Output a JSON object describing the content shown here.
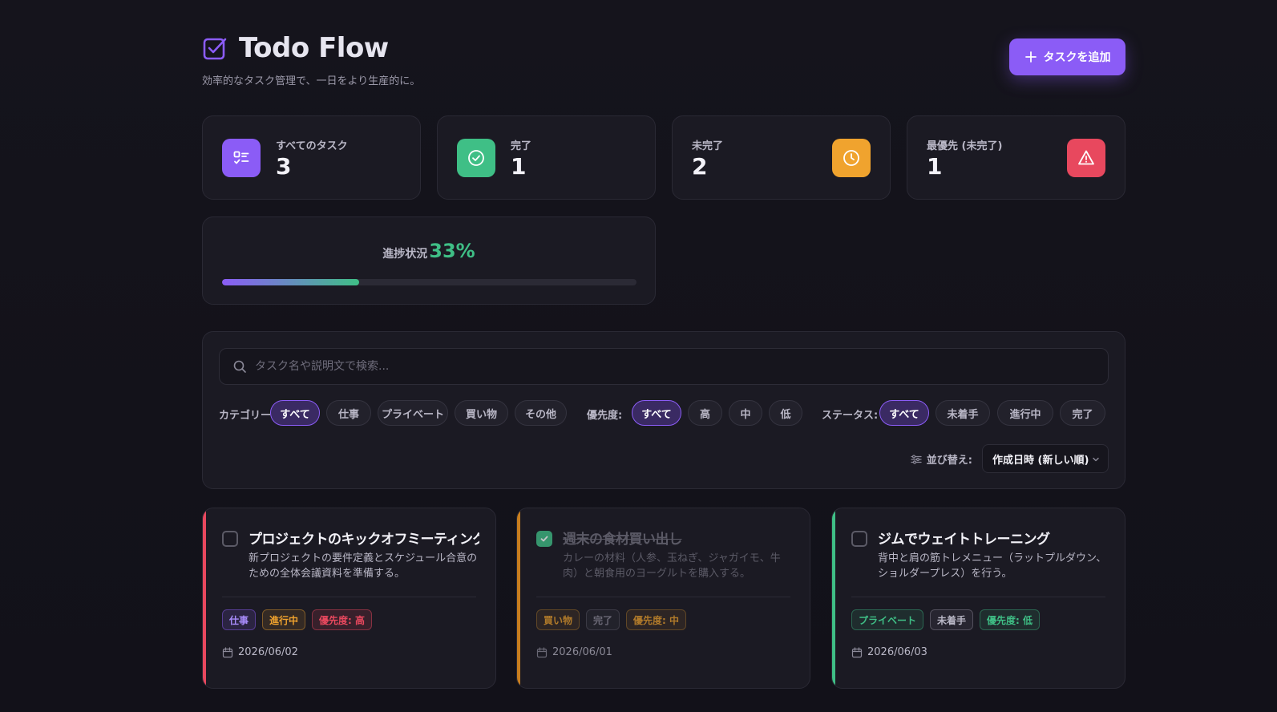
{
  "app": {
    "title": "Todo Flow",
    "subtitle": "効率的なタスク管理で、一日をより生産的に。",
    "add_button": "タスクを追加"
  },
  "colors": {
    "accent": "#8b5cf6",
    "success": "#3fbf86",
    "warning": "#f0a32e",
    "danger": "#e8485e"
  },
  "stats": [
    {
      "label": "すべてのタスク",
      "value": "3",
      "icon": "checklist-icon",
      "color": "#8b5cf6"
    },
    {
      "label": "完了",
      "value": "1",
      "icon": "check-circle-icon",
      "color": "#3fbf86"
    },
    {
      "label": "未完了",
      "value": "2",
      "icon": "clock-icon",
      "color": "#f0a32e"
    },
    {
      "label": "最優先 (未完了)",
      "value": "1",
      "icon": "alert-triangle-icon",
      "color": "#e8485e"
    }
  ],
  "progress": {
    "label": "進捗状況",
    "value_text": "33%",
    "fraction": 0.33
  },
  "search": {
    "placeholder": "タスク名や説明文で検索..."
  },
  "filters": {
    "category": {
      "label": "カテゴリー:",
      "options": [
        "すべて",
        "仕事",
        "プライベート",
        "買い物",
        "その他"
      ],
      "selected": "すべて"
    },
    "priority": {
      "label": "優先度:",
      "options": [
        "すべて",
        "高",
        "中",
        "低"
      ],
      "selected": "すべて"
    },
    "status": {
      "label": "ステータス:",
      "options": [
        "すべて",
        "未着手",
        "進行中",
        "完了"
      ],
      "selected": "すべて"
    }
  },
  "sort": {
    "label": "並び替え:",
    "value": "作成日時 (新しい順)"
  },
  "tasks": [
    {
      "title": "プロジェクトのキックオフミーティング",
      "description": "新プロジェクトの要件定義とスケジュール合意のための全体会議資料を準備する。",
      "completed": false,
      "accent": "#e8485e",
      "tags": [
        {
          "label": "仕事",
          "color": "#a78bfa"
        },
        {
          "label": "進行中",
          "color": "#f0a32e"
        },
        {
          "label": "優先度: 高",
          "color": "#e8485e"
        }
      ],
      "date": "2026/06/02"
    },
    {
      "title": "週末の食材買い出し",
      "description": "カレーの材料（人参、玉ねぎ、ジャガイモ、牛肉）と朝食用のヨーグルトを購入する。",
      "completed": true,
      "accent": "#f0a32e",
      "tags": [
        {
          "label": "買い物",
          "color": "#f0a32e"
        },
        {
          "label": "完了",
          "color": "#8c8a99"
        },
        {
          "label": "優先度: 中",
          "color": "#f0a32e"
        }
      ],
      "date": "2026/06/01"
    },
    {
      "title": "ジムでウェイトトレーニング",
      "description": "背中と肩の筋トレメニュー（ラットプルダウン、ショルダープレス）を行う。",
      "completed": false,
      "accent": "#3fbf86",
      "tags": [
        {
          "label": "プライベート",
          "color": "#3fbf86"
        },
        {
          "label": "未着手",
          "color": "#b9b7c6"
        },
        {
          "label": "優先度: 低",
          "color": "#3fbf86"
        }
      ],
      "date": "2026/06/03"
    }
  ]
}
